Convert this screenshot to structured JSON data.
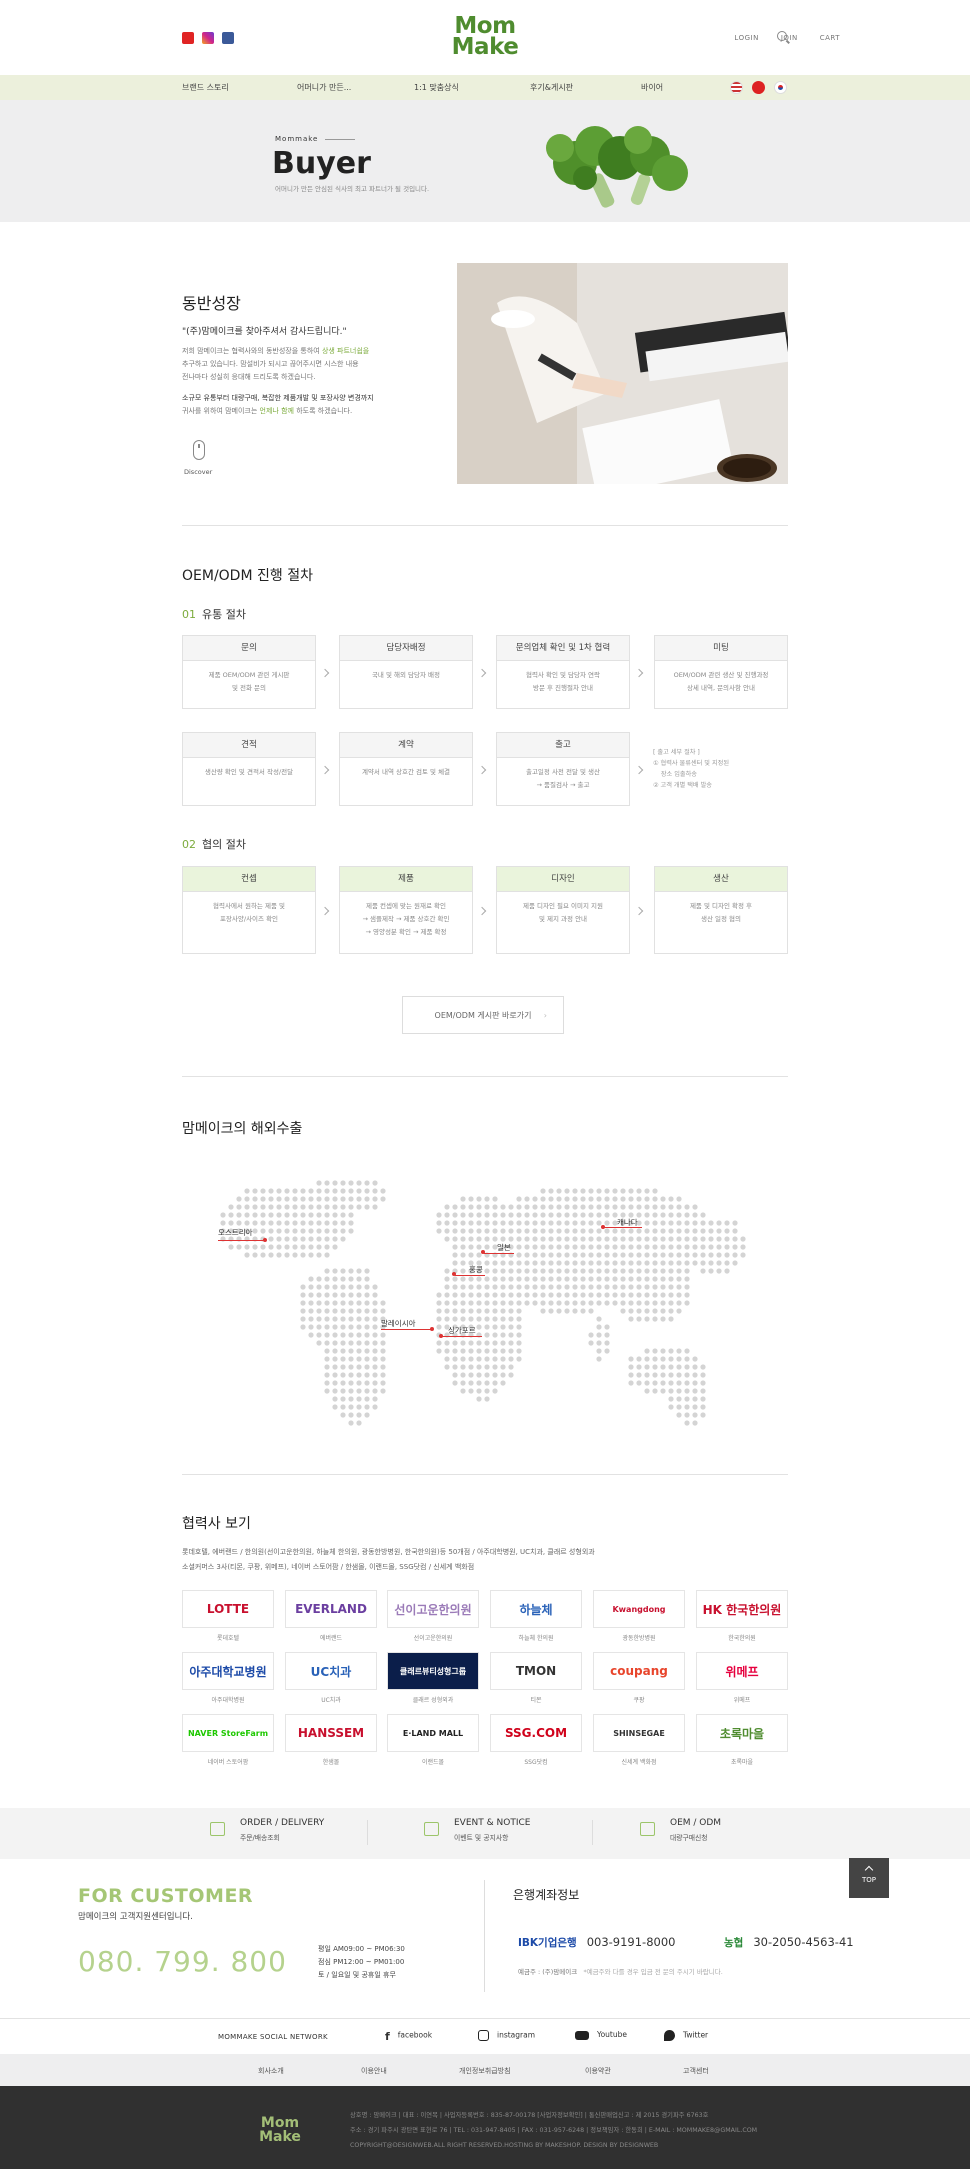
{
  "header": {
    "logo_line1": "Mom",
    "logo_line2": "Make",
    "login": "LOGIN",
    "join": "JOIN",
    "cart": "CART"
  },
  "gnb": [
    "브랜드 스토리",
    "어머니가 만든...",
    "1:1 맞춤상식",
    "후기&게시판",
    "바이어"
  ],
  "hero": {
    "sub": "Mommake",
    "title": "Buyer",
    "desc": "어머니가 만든 안심된 식사의 최고 파트너가 될 것입니다."
  },
  "intro": {
    "title": "동반성장",
    "quote": "\"(주)맘메이크를 찾아주셔서 감사드립니다.\"",
    "p1a": "저희 맘메이크는 협력사와의 동반성장을 통하여",
    "p1b": "상생 파트너쉽을",
    "p1c": "추구하고 있습니다. 맘설비가 되시고 끊어주시면 시스한 내용",
    "p1d": "전나마다 성실히 응대해 드리도록 하겠습니다.",
    "p2a": "소규모 유통부터 대량구매, 복잡한 제품개발 및 포장사양 변경까지",
    "p2b": "귀사를 위하여 맘메이크는",
    "p2c": "언제나 함께",
    "p2d": "하도록 하겠습니다.",
    "discover": "Discover"
  },
  "oem": {
    "title": "OEM/ODM 진행 절차",
    "step1_num": "01",
    "step1_title": "유통 절차",
    "step1_boxes": [
      {
        "title": "문의",
        "desc": "제품 OEM/ODM 관련 게시판\n및 전화 문의"
      },
      {
        "title": "담당자배정",
        "desc": "국내 및 해외 담당자 배정"
      },
      {
        "title": "문의업체 확인 및 1차 협력",
        "desc": "협력사 확인 및 담당자 연락\n방문 후 진행절차 안내"
      },
      {
        "title": "미팅",
        "desc": "OEM/ODM 관련 생산 및 진행과정\n상세 내역, 문의사항 안내"
      },
      {
        "title": "견적",
        "desc": "생산량 확인 및 견적서 작성/전달"
      },
      {
        "title": "계약",
        "desc": "계약서 내역 상호간 검토 및 체결"
      },
      {
        "title": "출고",
        "desc": "출고일정 사전 전달 및 생산\n→ 품질검사 → 출고"
      }
    ],
    "note": "[ 출고 세부 절차 ]\n① 협력사 물류센터 및 지정된\n    장소 입출하송\n② 고객 개별 택배 발송",
    "step2_num": "02",
    "step2_title": "협의 절차",
    "step2_boxes": [
      {
        "title": "컨셉",
        "desc": "협력사에서 원하는 제품 및\n포장사양/사이즈 확인"
      },
      {
        "title": "제품",
        "desc": "제품 컨셉에 맞는 원재료 확인\n→ 샘플제작 → 제품 상호간 확인\n→ 영양성분 확인 → 제품 확정"
      },
      {
        "title": "디자인",
        "desc": "제품 디자인 필요 이미지 지원\n및 제지 과정 안내"
      },
      {
        "title": "생산",
        "desc": "제품 및 디자인 확정 후\n생산 일정 협의"
      }
    ],
    "board_button": "OEM/ODM 게시판 바로가기"
  },
  "export": {
    "title": "맘메이크의 해외수출",
    "labels": [
      "오스트리아",
      "캐나다",
      "일본",
      "홍콩",
      "말레이시아",
      "싱가포르"
    ]
  },
  "partners": {
    "title": "협력사 보기",
    "desc_line1": "롯데호텔, 에버랜드 / 한의원(선이고운한의원, 하늘체 한의원, 광동한방병원, 한국한의원)등 50개점 / 아주대학병원, UC치과, 클래르 성형외과",
    "desc_line2": "소셜커머스 3사(티몬, 쿠팡, 위메프), 네이버 스토어팜 / 한샘몰, 이랜드몰, SSG닷컴 / 신세계 백화점",
    "items": [
      {
        "logo": "LOTTE",
        "name": "롯데호텔",
        "color": "#c8102e"
      },
      {
        "logo": "EVERLAND",
        "name": "에버랜드",
        "color": "#6b3fa0"
      },
      {
        "logo": "선이고운한의원",
        "name": "선이고운한의원",
        "color": "#9b7bb8"
      },
      {
        "logo": "하늘체",
        "name": "하늘체 한의원",
        "color": "#2a62b8"
      },
      {
        "logo": "Kwangdong",
        "name": "광동한방병원",
        "color": "#c8102e"
      },
      {
        "logo": "HK 한국한의원",
        "name": "한국한의원",
        "color": "#c8102e"
      },
      {
        "logo": "아주대학교병원",
        "name": "아주대학병원",
        "color": "#1c4aa8"
      },
      {
        "logo": "UC치과",
        "name": "UC치과",
        "color": "#2a62b8"
      },
      {
        "logo": "클래르뷰티성형그룹",
        "name": "클래르 성형외과",
        "color": "#ffffff"
      },
      {
        "logo": "TMON",
        "name": "티몬",
        "color": "#333333"
      },
      {
        "logo": "coupang",
        "name": "쿠팡",
        "color": "#e8452c"
      },
      {
        "logo": "위메프",
        "name": "위메프",
        "color": "#e6003e"
      },
      {
        "logo": "NAVER StoreFarm",
        "name": "네이버 스토어팜",
        "color": "#1ec800"
      },
      {
        "logo": "HANSSEM",
        "name": "한샘몰",
        "color": "#c8102e"
      },
      {
        "logo": "E·LAND MALL",
        "name": "이랜드몰",
        "color": "#222222"
      },
      {
        "logo": "SSG.COM",
        "name": "SSG닷컴",
        "color": "#d0021b"
      },
      {
        "logo": "SHINSEGAE",
        "name": "신세계 백화점",
        "color": "#333333"
      },
      {
        "logo": "초록마을",
        "name": "초록마을",
        "color": "#4f8c2f"
      }
    ]
  },
  "quick": [
    {
      "title": "ORDER / DELIVERY",
      "sub": "주문/배송조회"
    },
    {
      "title": "EVENT & NOTICE",
      "sub": "이벤트 및 공지사항"
    },
    {
      "title": "OEM / ODM",
      "sub": "대량구매신청"
    }
  ],
  "top_label": "TOP",
  "customer": {
    "title": "FOR CUSTOMER",
    "sub": "맘메이크의 고객지원센터입니다.",
    "phone": "080. 799. 800",
    "hours1": "평일  AM09:00 ~ PM06:30",
    "hours2": "점심  PM12:00 ~ PM01:00",
    "hours3": "토 / 일요일 및 공휴일 휴무"
  },
  "bank": {
    "title": "은행계좌정보",
    "ibk_name": "IBK기업은행",
    "ibk_account": "003-9191-8000",
    "nh_name": "농협",
    "nh_account": "30-2050-4563-41",
    "owner": "예금주 : (주)맘메이크",
    "owner_note": "*예금주와 다를 경우 입금 전 문의 주시기 바랍니다."
  },
  "social_row": {
    "label": "MOMMAKE SOCIAL NETWORK",
    "items": [
      "facebook",
      "instagram",
      "Youtube",
      "Twitter"
    ]
  },
  "footer_links": [
    "회사소개",
    "이용안내",
    "개인정보취급방침",
    "이용약관",
    "고객센터"
  ],
  "footer": {
    "logo_line1": "Mom",
    "logo_line2": "Make",
    "line1": "상호명 : 맘메이크 | 대표 : 이연복 | 사업자등록번호 : 835-87-00178 [사업자정보확인] | 통신판매업신고 : 제 2015 경기파주 6763호",
    "line2": "주소 : 경기 파주시 광탄면 표현로 76 | TEL : 031-947-8405 | FAX : 031-957-6248 | 정보책임자 : 한동희 | E-MAIL : MOMMAKE8@GMAIL.COM",
    "line3": "COPYRIGHT@DESIGNWEB.ALL RIGHT RESERVED.HOSTING BY MAKESHOP. DESIGN BY DESIGNWEB"
  }
}
